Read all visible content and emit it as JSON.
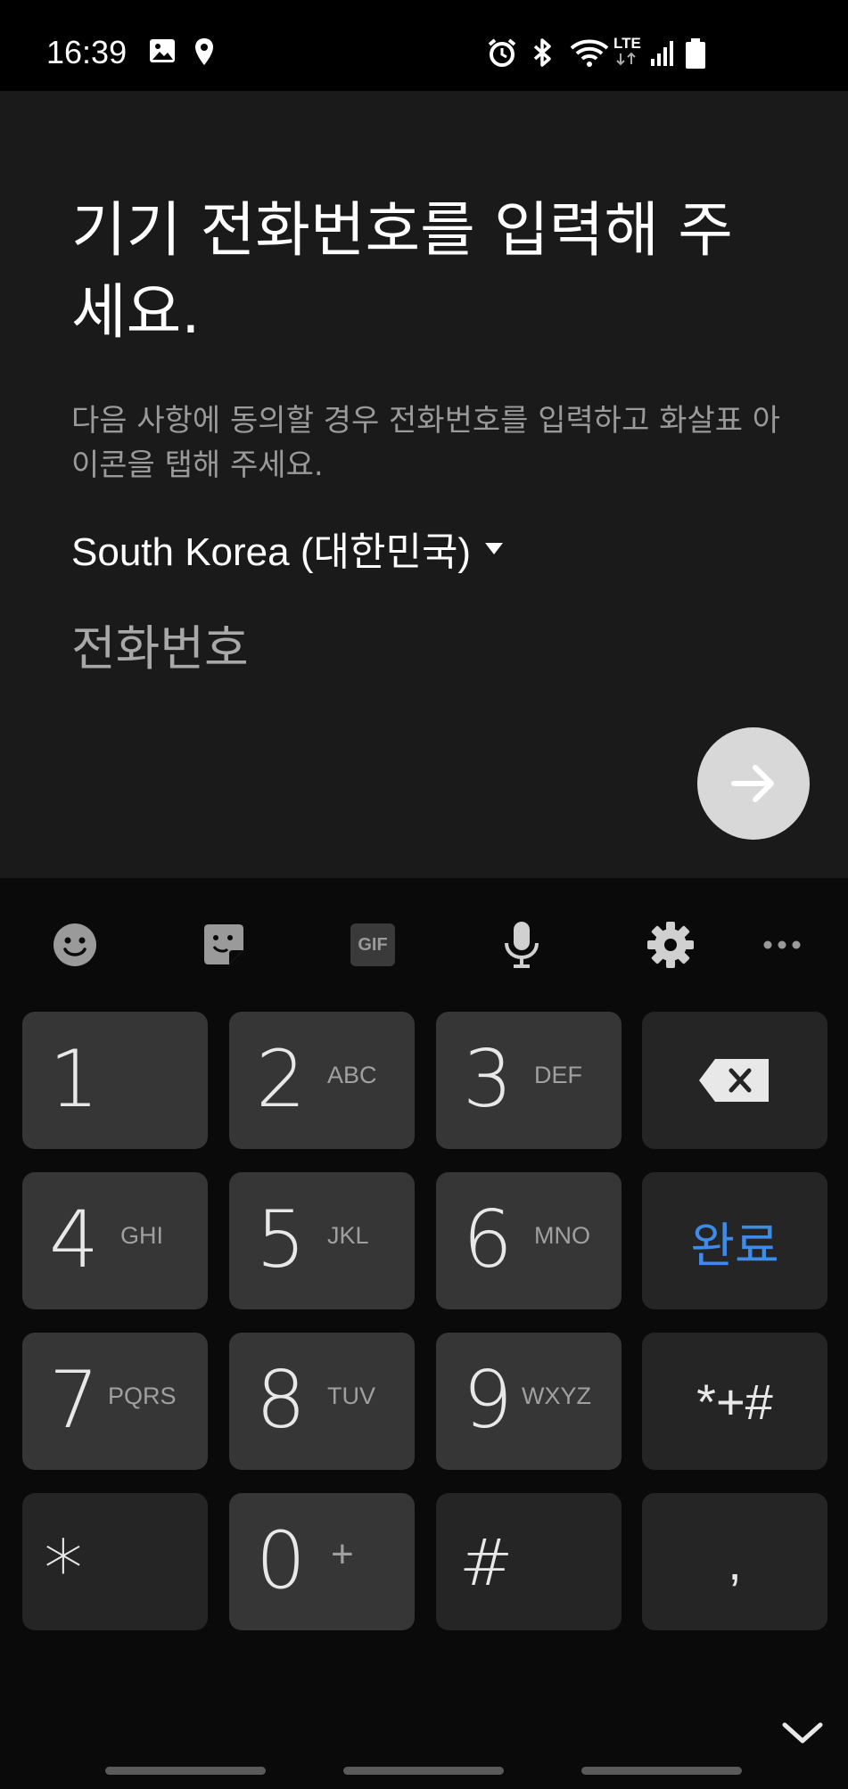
{
  "status_bar": {
    "time": "16:39",
    "left_icons": [
      "gallery-icon",
      "location-icon"
    ],
    "right_icons": [
      "alarm-icon",
      "bluetooth-icon",
      "wifi-icon",
      "lte-icon",
      "signal-icon",
      "battery-icon"
    ],
    "network_label": "LTE"
  },
  "screen": {
    "title": "기기 전화번호를 입력해 주세요.",
    "subtitle": "다음 사항에 동의할 경우 전화번호를 입력하고 화살표 아이콘을 탭해 주세요.",
    "country_selector": "South Korea (대한민국)",
    "phone_input": {
      "value": "",
      "placeholder": "전화번호"
    },
    "next_button_icon": "arrow-right-icon"
  },
  "keyboard": {
    "toolbar": [
      "emoji-icon",
      "sticker-icon",
      "gif-icon",
      "microphone-icon",
      "settings-icon",
      "more-icon"
    ],
    "gif_label": "GIF",
    "keys": {
      "k1": {
        "num": "1",
        "letters": ""
      },
      "k2": {
        "num": "2",
        "letters": "ABC"
      },
      "k3": {
        "num": "3",
        "letters": "DEF"
      },
      "k4": {
        "num": "4",
        "letters": "GHI"
      },
      "k5": {
        "num": "5",
        "letters": "JKL"
      },
      "k6": {
        "num": "6",
        "letters": "MNO"
      },
      "k7": {
        "num": "7",
        "letters": "PQRS"
      },
      "k8": {
        "num": "8",
        "letters": "TUV"
      },
      "k9": {
        "num": "9",
        "letters": "WXYZ"
      },
      "k0": {
        "num": "0",
        "letters": "+"
      },
      "star": "*",
      "hash": "#",
      "comma": ",",
      "symbols": "*+#",
      "done": "완료"
    },
    "accent_color": "#3f8ce8"
  }
}
